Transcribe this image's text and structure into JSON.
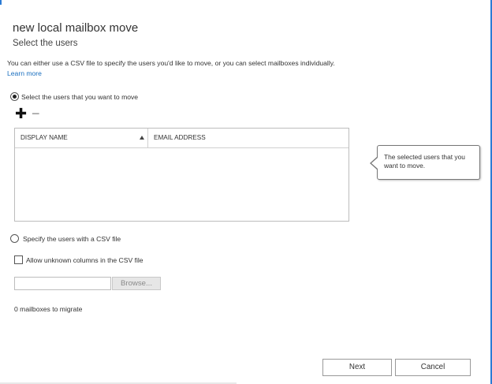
{
  "dialog": {
    "title": "new local mailbox move",
    "subtitle": "Select the users",
    "intro_text": "You can either use a CSV file to specify the users you'd like to move, or you can select mailboxes individually.",
    "learn_more": "Learn more"
  },
  "select_users": {
    "radio_label": "Select the users that you want to move",
    "selected": true,
    "add_icon": "plus-icon",
    "remove_icon": "minus-icon",
    "columns": [
      "DISPLAY NAME",
      "EMAIL ADDRESS"
    ],
    "sort_column": "DISPLAY NAME",
    "sort_direction": "ascending",
    "rows": []
  },
  "tooltip": {
    "text": "The selected users that you want to move."
  },
  "csv": {
    "radio_label": "Specify the users with a CSV file",
    "selected": false,
    "allow_unknown_label": "Allow unknown columns in the CSV file",
    "allow_unknown_checked": false,
    "file_value": "",
    "browse_label": "Browse..."
  },
  "status": {
    "text": "0 mailboxes to migrate"
  },
  "footer": {
    "next_label": "Next",
    "cancel_label": "Cancel"
  },
  "colors": {
    "accent": "#2b7bd4",
    "link": "#1a6fbf"
  }
}
